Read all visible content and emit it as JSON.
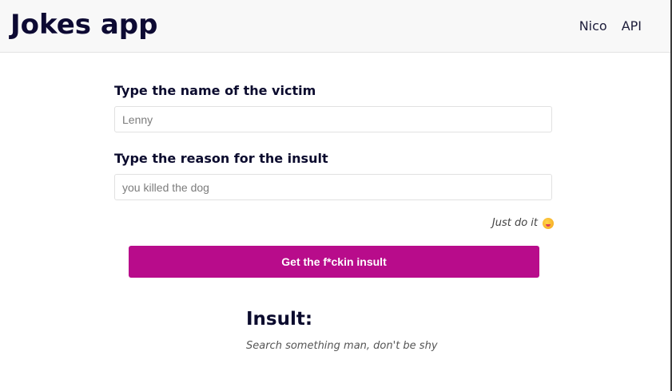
{
  "navbar": {
    "brand": "Jokes app",
    "links": [
      "Nico",
      "API"
    ]
  },
  "form": {
    "victim_label": "Type the name of the victim",
    "victim_placeholder": "Lenny",
    "reason_label": "Type the reason for the insult",
    "reason_placeholder": "you killed the dog",
    "hint": "Just do it",
    "hint_icon": "winking-tongue-emoji-icon",
    "submit_label": "Get the f*ckin insult",
    "submit_color": "#b80c8b"
  },
  "result": {
    "title": "Insult:",
    "text": "Search something man, don't be shy"
  }
}
